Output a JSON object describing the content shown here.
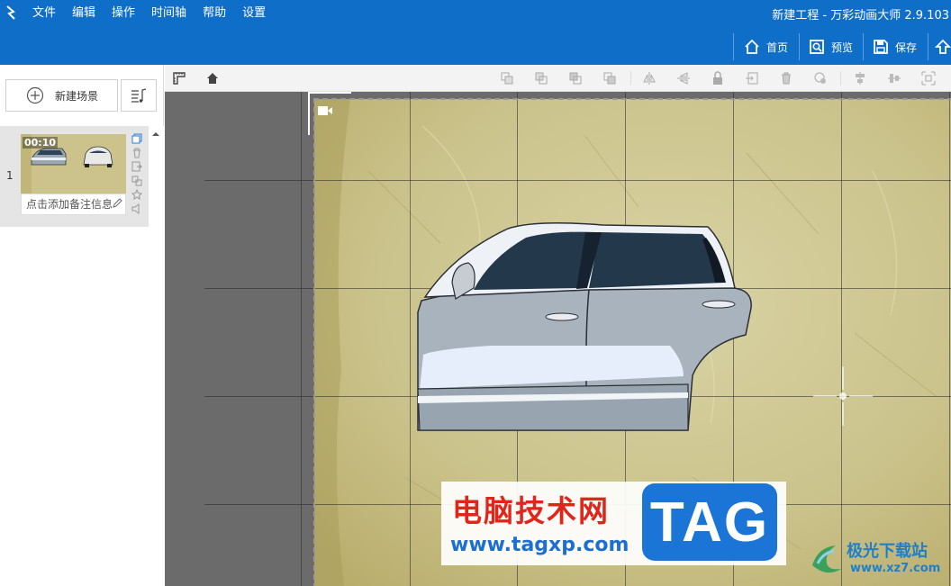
{
  "menubar": {
    "items": [
      "文件",
      "编辑",
      "操作",
      "时间轴",
      "帮助",
      "设置"
    ],
    "title": "新建工程 - 万彩动画大师 2.9.103"
  },
  "actionbar": {
    "home": "首页",
    "preview": "预览",
    "save": "保存"
  },
  "left_panel": {
    "new_scene": "新建场景",
    "scene": {
      "index": "1",
      "duration": "00:10",
      "note_placeholder": "点击添加备注信息"
    }
  },
  "watermark": {
    "title": "电脑技术网",
    "tag": "TAG",
    "url": "www.tagxp.com",
    "site_title": "极光下载站",
    "site_url": "www.xz7.com"
  },
  "colors": {
    "brand_blue": "#0f6ec8",
    "stage_bg": "#c9bf86",
    "workspace_bg": "#6b6b6b"
  }
}
